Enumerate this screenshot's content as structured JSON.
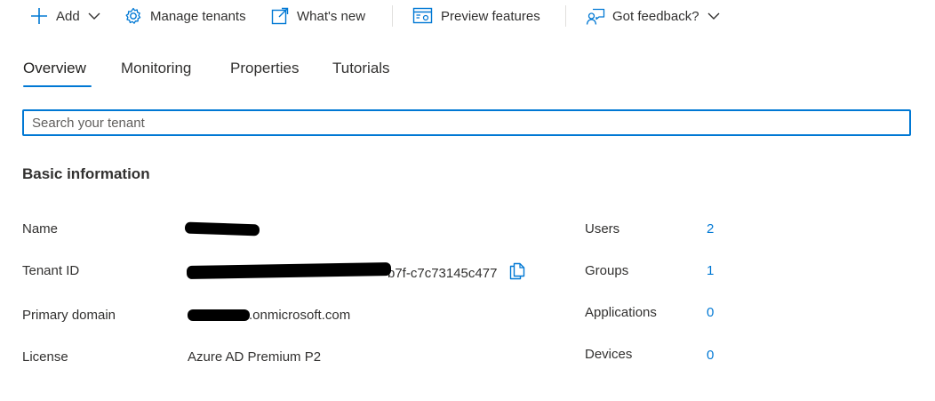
{
  "toolbar": {
    "add_label": "Add",
    "manage_tenants_label": "Manage tenants",
    "whats_new_label": "What's new",
    "preview_features_label": "Preview features",
    "feedback_label": "Got feedback?"
  },
  "tabs": [
    {
      "label": "Overview"
    },
    {
      "label": "Monitoring"
    },
    {
      "label": "Properties"
    },
    {
      "label": "Tutorials"
    }
  ],
  "search": {
    "placeholder": "Search your tenant"
  },
  "basic_info": {
    "title": "Basic information",
    "rows": [
      {
        "label": "Name",
        "value": ""
      },
      {
        "label": "Tenant ID",
        "value": "b7f-c7c73145c477"
      },
      {
        "label": "Primary domain",
        "value": ".onmicrosoft.com"
      },
      {
        "label": "License",
        "value": "Azure AD Premium P2"
      }
    ],
    "stats": [
      {
        "label": "Users",
        "value": "2"
      },
      {
        "label": "Groups",
        "value": "1"
      },
      {
        "label": "Applications",
        "value": "0"
      },
      {
        "label": "Devices",
        "value": "0"
      }
    ]
  },
  "colors": {
    "accent": "#0078d4",
    "text": "#323130",
    "redaction": "#000000"
  },
  "icons": {
    "add": "plus-icon",
    "manage_tenants": "gear-icon",
    "whats_new": "external-link-icon",
    "preview_features": "preview-features-icon",
    "feedback": "feedback-person-icon",
    "copy": "copy-icon"
  }
}
